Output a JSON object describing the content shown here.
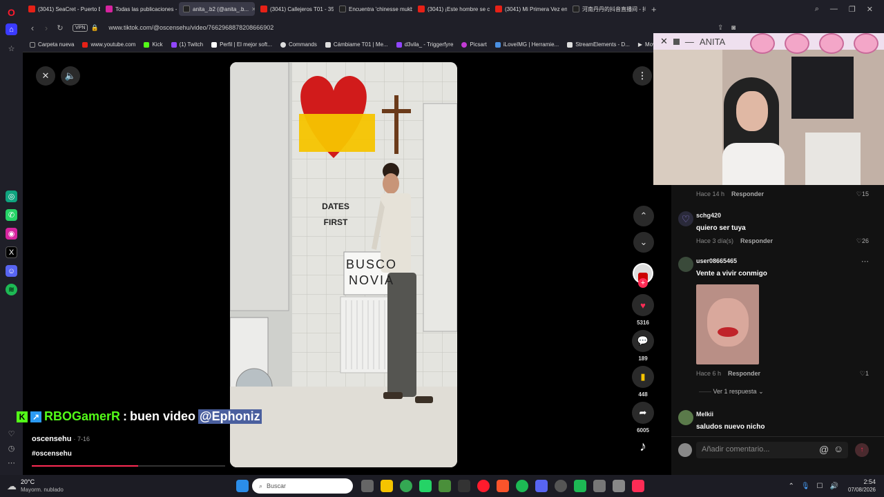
{
  "tabs": [
    {
      "title": "(3041) SeaCret - Puerto Es",
      "color": "#e62117"
    },
    {
      "title": "Todas las publicaciones -",
      "color": "#d6249f"
    },
    {
      "title": "anita_.b2 (@anita_.b...",
      "color": "#222"
    },
    {
      "title": "(3041) Callejeros T01 - 35",
      "color": "#e62117"
    },
    {
      "title": "Encuentra 'chinesse mukb",
      "color": "#222"
    },
    {
      "title": "(3041) ¡Este hombre se co",
      "color": "#e62117"
    },
    {
      "title": "(3041) Mi Primera Vez en",
      "color": "#e62117"
    },
    {
      "title": "河南丹丹的抖音直播间 - 抖",
      "color": "#222"
    }
  ],
  "address": {
    "vpn": "VPN",
    "url": "www.tiktok.com/@oscensehu/video/7662968878208666902"
  },
  "bookmarks": [
    {
      "label": "Carpeta nueva",
      "color": "#999"
    },
    {
      "label": "www.youtube.com",
      "color": "#e62117"
    },
    {
      "label": "Kick",
      "color": "#53fc18"
    },
    {
      "label": "(1) Twitch",
      "color": "#9146ff"
    },
    {
      "label": "Perfil | El mejor soft...",
      "color": "#fff"
    },
    {
      "label": "Commands",
      "color": "#ddd"
    },
    {
      "label": "Cámbiame T01 | Me...",
      "color": "#ddd"
    },
    {
      "label": "d3vila_ - Triggerfyre",
      "color": "#9146ff"
    },
    {
      "label": "Picsart",
      "color": "#c23bd4"
    },
    {
      "label": "iLoveIMG | Herramie...",
      "color": "#4a90e2"
    },
    {
      "label": "StreamElements - D...",
      "color": "#ddd"
    },
    {
      "label": "Movies / TV",
      "color": "#ddd"
    }
  ],
  "video": {
    "sign_line1": "DATES",
    "sign_line2": "FIRST",
    "paper_line1": "BUSCO",
    "paper_line2": "NOVIA",
    "author": "oscensehu",
    "date": "· 7-16",
    "hashtag": "#oscensehu"
  },
  "chat": {
    "user": "RBOGamerR",
    "sep": ":",
    "message": "buen video",
    "mention": "@Ephoniz"
  },
  "rail": {
    "likes": "5316",
    "comments": "189",
    "saves": "448",
    "shares": "6005"
  },
  "overlay": {
    "title": "ANITA"
  },
  "comments": [
    {
      "user": "",
      "text": "",
      "time": "Hace 14 h",
      "reply": "Responder",
      "likes": "15"
    },
    {
      "user": "schg420",
      "text": "quiero ser tuya",
      "time": "Hace 3 día(s)",
      "reply": "Responder",
      "likes": "26"
    },
    {
      "user": "user08665465",
      "text": "Vente a vivir conmigo",
      "time": "Hace 6 h",
      "reply": "Responder",
      "likes": "1",
      "more": "Ver 1 respuesta"
    },
    {
      "user": "Melkii",
      "text": "saludos nuevo nicho"
    }
  ],
  "comment_input": {
    "placeholder": "Añadir comentario...",
    "at": "@"
  },
  "taskbar": {
    "temp": "20°C",
    "weather": "Mayorm. nublado",
    "search": "Buscar",
    "time": "2:54",
    "date": "07/08/2026"
  }
}
